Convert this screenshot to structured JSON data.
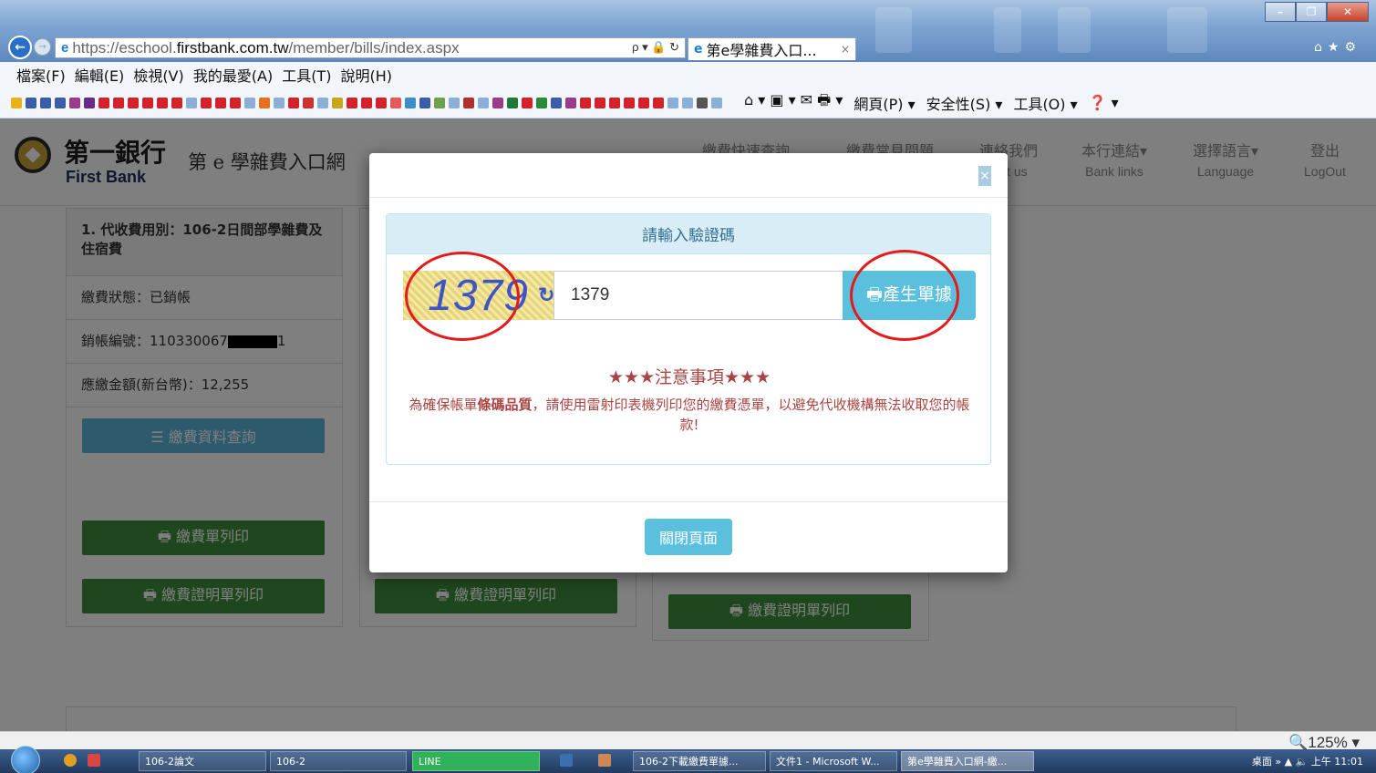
{
  "browser": {
    "url_prefix": "https://eschool.",
    "url_domain": "firstbank.com.tw",
    "url_path": "/member/bills/index.aspx",
    "tab_title": "第e學雜費入口...",
    "tab_close": "×",
    "addr_tools": "ρ ▾ 🔒 ↻"
  },
  "menu": [
    "檔案(F)",
    "編輯(E)",
    "檢視(V)",
    "我的最愛(A)",
    "工具(T)",
    "說明(H)"
  ],
  "commandbar": {
    "page": "網頁(P) ▾",
    "safety": "安全性(S) ▾",
    "tools": "工具(O) ▾",
    "help": "❓ ▾"
  },
  "header": {
    "bank_zh": "第一銀行",
    "bank_en": "First Bank",
    "site_title": "第 e 學雜費入口網",
    "nav": [
      {
        "zh": "繳費快速查詢",
        "en": ""
      },
      {
        "zh": "繳費常見問題",
        "en": ""
      },
      {
        "zh": "連絡我們",
        "en": "tact us"
      },
      {
        "zh": "本行連結▾",
        "en": "Bank links"
      },
      {
        "zh": "選擇語言▾",
        "en": "Language"
      },
      {
        "zh": "登出",
        "en": "LogOut"
      }
    ]
  },
  "card": {
    "category": "1. 代收費用別：106-2日間部學雜費及住宿費",
    "status_label": "繳費狀態：",
    "status_value": "已銷帳",
    "account_label": "銷帳編號：",
    "account_prefix": "110330067",
    "account_suffix": "1",
    "amount_label": "應繳金額(新台幣)：",
    "amount_value": "12,255",
    "query_btn": "☰ 繳費資料查詢",
    "print_bill_btn": "🖶 繳費單列印",
    "print_cert_btn": "🖶 繳費證明單列印"
  },
  "modal": {
    "close": "×",
    "panel_title": "請輸入驗證碼",
    "captcha_text": "1379",
    "refresh_icon": "↻",
    "input_value": "1379",
    "generate_btn": "🖶產生單據",
    "notice_title": "★★★注意事項★★★",
    "notice_pre": "為確保帳單",
    "notice_bold": "條碼品質",
    "notice_post": "，請使用雷射印表機列印您的繳費憑單，以避免代收機構無法收取您的帳款!",
    "close_page_btn": "關閉頁面"
  },
  "status": {
    "zoom": "🔍125% ▾"
  },
  "taskbar": {
    "tasks": [
      "106-2論文",
      "106-2",
      "LINE",
      "106-2下載繳費單據...",
      "文件1 - Microsoft W...",
      "第e學雜費入口網-繳..."
    ],
    "tray": "桌面 » ▲ 🔈 上午 11:01"
  },
  "colors": {
    "accent_info": "#5bc0de",
    "btn_green": "#3c8f3b",
    "annotation_red": "#e31b1b",
    "notice_red": "#a94442"
  }
}
